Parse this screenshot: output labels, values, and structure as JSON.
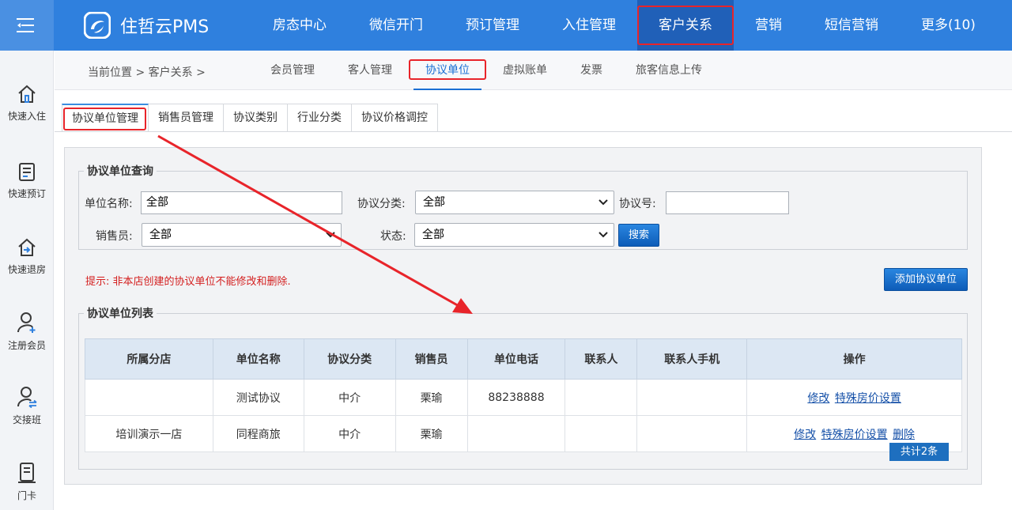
{
  "header": {
    "logo_text": "住哲云PMS",
    "nav": [
      "房态中心",
      "微信开门",
      "预订管理",
      "入住管理",
      "客户关系",
      "营销",
      "短信营销",
      "更多(10)"
    ],
    "active_index": 4
  },
  "sidebar": {
    "items": [
      {
        "label": "快速入住",
        "icon": "house-icon"
      },
      {
        "label": "快速预订",
        "icon": "booking-icon"
      },
      {
        "label": "快速退房",
        "icon": "checkout-icon"
      },
      {
        "label": "注册会员",
        "icon": "add-user-icon"
      },
      {
        "label": "交接班",
        "icon": "shift-handover-icon"
      },
      {
        "label": "门卡",
        "icon": "door-card-icon"
      }
    ]
  },
  "breadcrumb": {
    "text": "当前位置 > 客户关系 >"
  },
  "subnav": {
    "items": [
      "会员管理",
      "客人管理",
      "协议单位",
      "虚拟账单",
      "发票",
      "旅客信息上传"
    ],
    "active_index": 2
  },
  "tabs": {
    "items": [
      "协议单位管理",
      "销售员管理",
      "协议类别",
      "行业分类",
      "协议价格调控"
    ],
    "active_index": 0
  },
  "query": {
    "legend": "协议单位查询",
    "unit_name_label": "单位名称:",
    "unit_name_value": "全部",
    "category_label": "协议分类:",
    "category_value": "全部",
    "code_label": "协议号:",
    "code_value": "",
    "sales_label": "销售员:",
    "sales_value": "全部",
    "status_label": "状态:",
    "status_value": "全部",
    "search_label": "搜索"
  },
  "hint": "提示: 非本店创建的协议单位不能修改和删除.",
  "add_button_label": "添加协议单位",
  "list": {
    "legend": "协议单位列表",
    "columns": [
      "所属分店",
      "单位名称",
      "协议分类",
      "销售员",
      "单位电话",
      "联系人",
      "联系人手机",
      "操作"
    ],
    "rows": [
      {
        "branch": "",
        "name": "测试协议",
        "category": "中介",
        "sales": "栗瑜",
        "phone": "88238888",
        "contact": "",
        "mobile": "",
        "actions": [
          "修改",
          "特殊房价设置"
        ]
      },
      {
        "branch": "培训演示一店",
        "name": "同程商旅",
        "category": "中介",
        "sales": "栗瑜",
        "phone": "",
        "contact": "",
        "mobile": "",
        "actions": [
          "修改",
          "特殊房价设置",
          "删除"
        ]
      }
    ],
    "total": "共计2条"
  },
  "colors": {
    "header_bg": "#2f80de",
    "active_nav_bg": "#2060b8",
    "highlight_border": "#e8242a",
    "link": "#1550a8"
  }
}
